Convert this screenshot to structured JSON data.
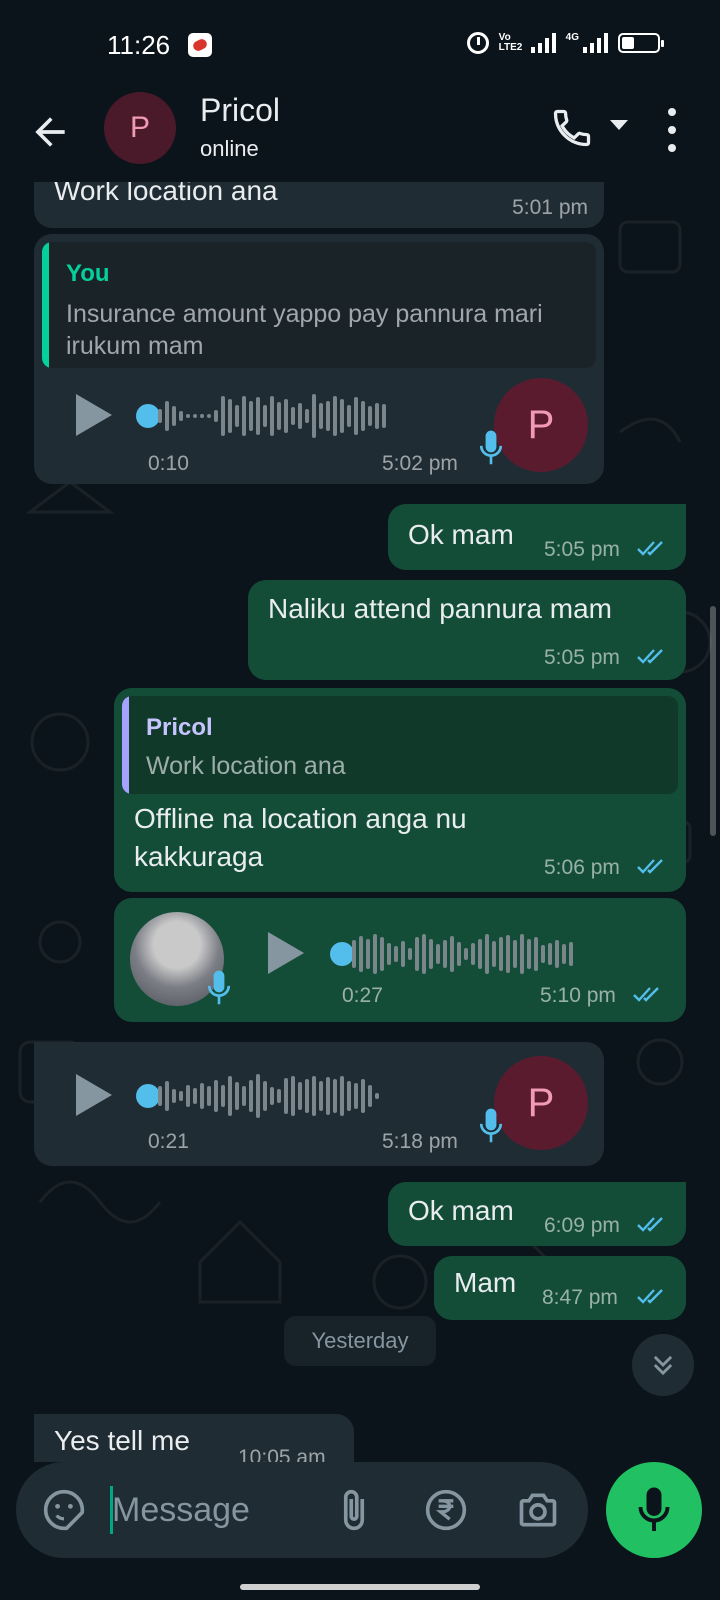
{
  "status_bar": {
    "time": "11:26",
    "volte": "Vo LTE2",
    "network": "4G"
  },
  "header": {
    "contact_name": "Pricol",
    "status": "online",
    "avatar_letter": "P"
  },
  "messages": {
    "m1": {
      "text": "Work location ana",
      "time": "5:01 pm"
    },
    "m2": {
      "quote_name": "You",
      "quote_text": "Insurance amount yappo pay pannura mari irukum mam",
      "duration": "0:10",
      "time": "5:02 pm",
      "avatar_letter": "P"
    },
    "m3": {
      "text": "Ok mam",
      "time": "5:05 pm"
    },
    "m4": {
      "text": "Naliku attend pannura mam",
      "time": "5:05 pm"
    },
    "m5": {
      "quote_name": "Pricol",
      "quote_text": "Work location ana",
      "text": "Offline na location anga nu kakkuraga",
      "time": "5:06 pm"
    },
    "m6": {
      "duration": "0:27",
      "time": "5:10 pm"
    },
    "m7": {
      "duration": "0:21",
      "time": "5:18 pm",
      "avatar_letter": "P"
    },
    "m8": {
      "text": "Ok mam",
      "time": "6:09 pm"
    },
    "m9": {
      "text": "Mam",
      "time": "8:47 pm"
    },
    "m10": {
      "text": "Yes tell me",
      "time": "10:05 am"
    }
  },
  "date_divider": "Yesterday",
  "composer": {
    "placeholder": "Message"
  },
  "colors": {
    "incoming": "#202c33",
    "outgoing": "#144d37",
    "accent": "#21c063",
    "read_ticks": "#53bdeb",
    "quote_you": "#06cf9c",
    "quote_pricol": "#a5a3ff"
  },
  "icons": [
    "back-arrow-icon",
    "phone-icon",
    "dropdown-icon",
    "more-vert-icon",
    "play-icon",
    "mic-icon",
    "double-tick-icon",
    "chevrons-down-icon",
    "sticker-icon",
    "paperclip-icon",
    "rupee-icon",
    "camera-icon"
  ]
}
